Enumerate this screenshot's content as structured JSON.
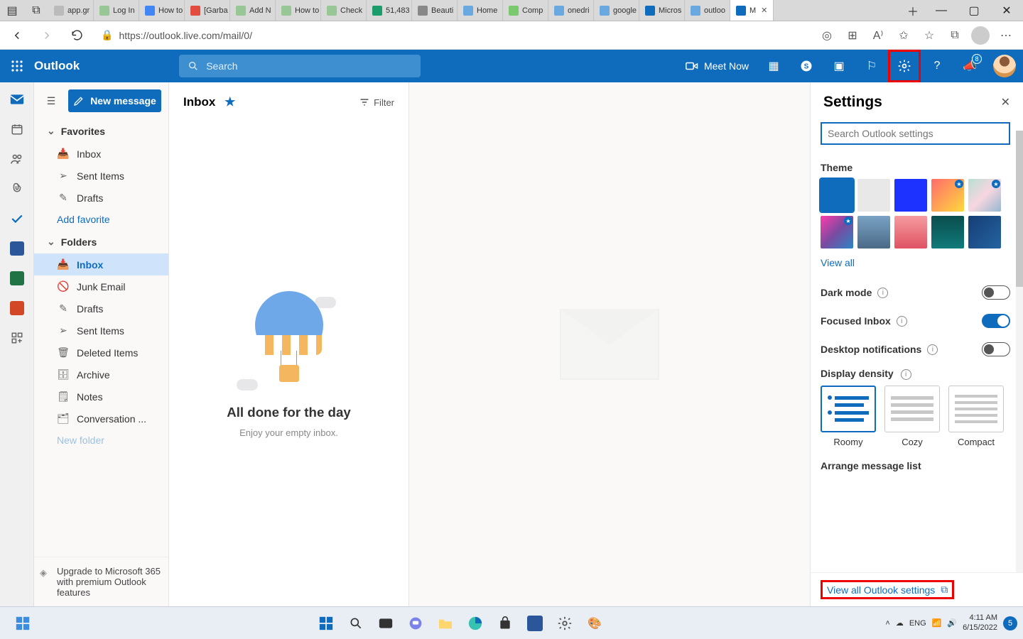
{
  "titlebar": {
    "tabs": [
      {
        "label": "app.gr",
        "icon": "#bbb"
      },
      {
        "label": "Log In",
        "icon": "#97c797"
      },
      {
        "label": "How to",
        "icon": "#4285f4"
      },
      {
        "label": "[Garba",
        "icon": "#e24c3f"
      },
      {
        "label": "Add N",
        "icon": "#97c797"
      },
      {
        "label": "How to",
        "icon": "#97c797"
      },
      {
        "label": "Check",
        "icon": "#97c797"
      },
      {
        "label": "51,483",
        "icon": "#1a9c6b"
      },
      {
        "label": "Beauti",
        "icon": "#888"
      },
      {
        "label": "Home",
        "icon": "#6aa9e0"
      },
      {
        "label": "Comp",
        "icon": "#7bc96f"
      },
      {
        "label": "onedri",
        "icon": "#6aa9e0"
      },
      {
        "label": "google",
        "icon": "#6aa9e0"
      },
      {
        "label": "Micros",
        "icon": "#0f6cbd"
      },
      {
        "label": "outloo",
        "icon": "#6aa9e0"
      },
      {
        "label": "M",
        "icon": "#0f6cbd",
        "active": true
      }
    ]
  },
  "addressbar": {
    "url": "https://outlook.live.com/mail/0/"
  },
  "suitebar": {
    "brand": "Outlook",
    "search_placeholder": "Search",
    "meet": "Meet Now",
    "badge": "8"
  },
  "nav": {
    "new_message": "New message",
    "favorites": "Favorites",
    "fav_items": [
      {
        "label": "Inbox",
        "icon": "inbox"
      },
      {
        "label": "Sent Items",
        "icon": "send"
      },
      {
        "label": "Drafts",
        "icon": "draft"
      }
    ],
    "add_favorite": "Add favorite",
    "folders": "Folders",
    "folder_items": [
      {
        "label": "Inbox",
        "icon": "inbox",
        "active": true
      },
      {
        "label": "Junk Email",
        "icon": "junk"
      },
      {
        "label": "Drafts",
        "icon": "draft"
      },
      {
        "label": "Sent Items",
        "icon": "send"
      },
      {
        "label": "Deleted Items",
        "icon": "trash"
      },
      {
        "label": "Archive",
        "icon": "archive"
      },
      {
        "label": "Notes",
        "icon": "note"
      },
      {
        "label": "Conversation ...",
        "icon": "conv"
      }
    ],
    "new_folder": "New folder",
    "upgrade": "Upgrade to Microsoft 365 with premium Outlook features"
  },
  "list": {
    "title": "Inbox",
    "filter": "Filter",
    "empty_title": "All done for the day",
    "empty_sub": "Enjoy your empty inbox."
  },
  "settings": {
    "title": "Settings",
    "search_placeholder": "Search Outlook settings",
    "theme_label": "Theme",
    "view_all": "View all",
    "dark_mode": "Dark mode",
    "focused": "Focused Inbox",
    "desktop": "Desktop notifications",
    "density_label": "Display density",
    "density": [
      "Roomy",
      "Cozy",
      "Compact"
    ],
    "arrange": "Arrange message list",
    "view_all_settings": "View all Outlook settings"
  },
  "themes": [
    {
      "bg": "#0f6cbd",
      "sel": true
    },
    {
      "bg": "#e8e8e8"
    },
    {
      "bg": "#1e32ff"
    },
    {
      "bg": "linear-gradient(135deg,#ff6b6b,#ffd93d)",
      "star": true
    },
    {
      "bg": "linear-gradient(135deg,#b8e0d2,#f7d6e0,#95b8d1)",
      "star": true
    },
    {
      "bg": "linear-gradient(135deg,#ff3cac,#784ba0,#2b86c5)",
      "star": true
    },
    {
      "bg": "linear-gradient(#7aa2c4,#4a6a86)"
    },
    {
      "bg": "linear-gradient(#f59ca0,#e05263)"
    },
    {
      "bg": "linear-gradient(#0a4d4d,#117a7a)"
    },
    {
      "bg": "linear-gradient(135deg,#153e75,#2563a0)"
    }
  ],
  "taskbar": {
    "time": "4:11 AM",
    "date": "6/15/2022",
    "noti": "5"
  }
}
